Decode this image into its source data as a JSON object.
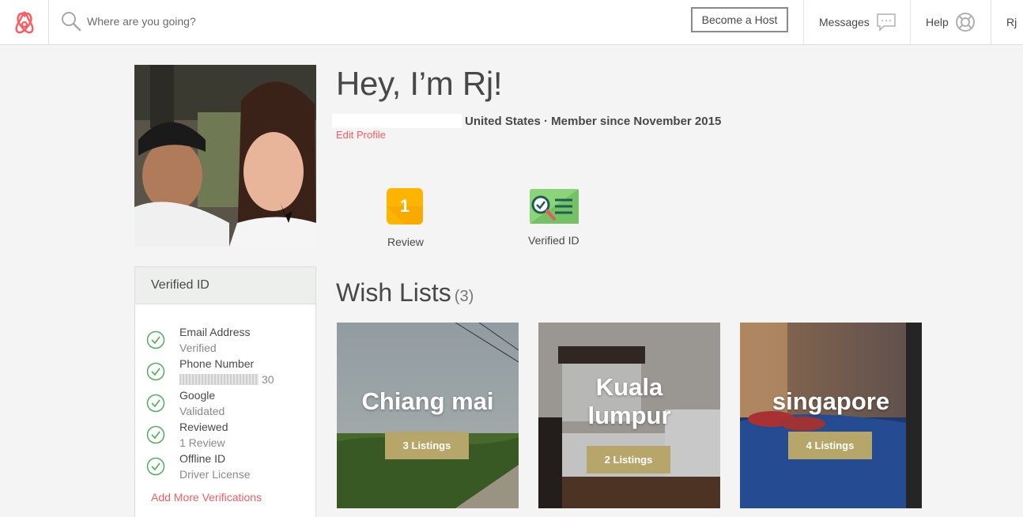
{
  "nav": {
    "search_placeholder": "Where are you going?",
    "become_host": "Become a Host",
    "messages": "Messages",
    "help": "Help",
    "user": "Rj",
    "brand_color": "#ff5a5f"
  },
  "profile": {
    "title": "Hey, I’m Rj!",
    "location": "United States · Member since November 2015",
    "edit_link": "Edit Profile"
  },
  "badges": {
    "review_count": "1",
    "review_label": "Review",
    "verified_label": "Verified ID"
  },
  "verification": {
    "header": "Verified ID",
    "items": [
      {
        "title": "Email Address",
        "sub": "Verified"
      },
      {
        "title": "Phone Number",
        "sub": "30"
      },
      {
        "title": "Google",
        "sub": "Validated"
      },
      {
        "title": "Reviewed",
        "sub": "1 Review"
      },
      {
        "title": "Offline ID",
        "sub": "Driver License"
      }
    ],
    "add_more": "Add More Verifications"
  },
  "wishlists": {
    "title": "Wish Lists",
    "count": "(3)",
    "cards": [
      {
        "name": "Chiang mai",
        "listings": "3 Listings"
      },
      {
        "name": "Kuala lumpur",
        "name_line1": "Kuala",
        "name_line2": "lumpur",
        "listings": "2 Listings"
      },
      {
        "name": "singapore",
        "listings": "4 Listings"
      }
    ]
  }
}
